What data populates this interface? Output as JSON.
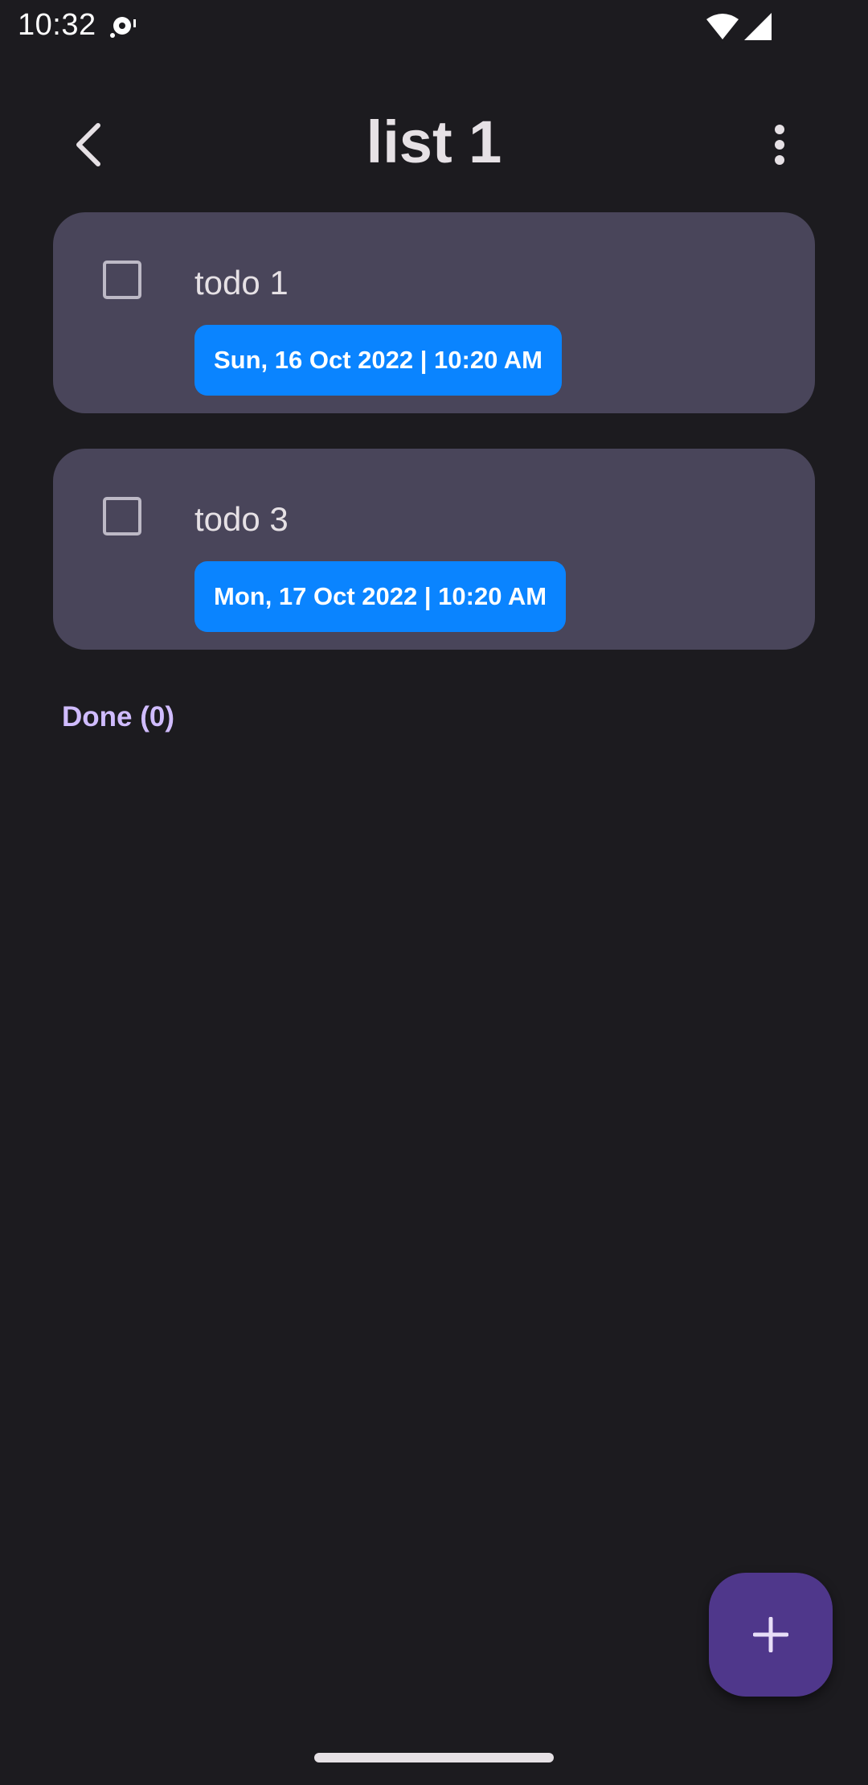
{
  "status_bar": {
    "time": "10:32",
    "icons": [
      "media-sync-icon",
      "wifi-icon",
      "cell-signal-icon"
    ]
  },
  "top_bar": {
    "title": "list 1",
    "back_icon": "chevron-left-icon",
    "menu_icon": "more-vert-icon"
  },
  "todos": [
    {
      "title": "todo 1",
      "date": "Sun, 16 Oct 2022 | 10:20 AM",
      "checked": false
    },
    {
      "title": "todo 3",
      "date": "Mon, 17 Oct 2022 | 10:20 AM",
      "checked": false
    }
  ],
  "done_section": {
    "label": "Done (0)"
  },
  "fab": {
    "icon": "plus-icon"
  },
  "colors": {
    "background": "#1c1b1f",
    "card": "#49455a",
    "chip": "#0a84ff",
    "accent_text": "#d0bcff",
    "fab": "#4f378b"
  }
}
